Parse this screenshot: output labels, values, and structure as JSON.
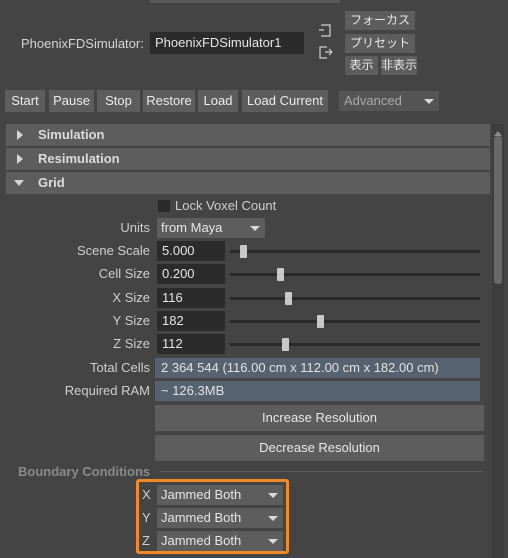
{
  "header": {
    "node_label": "PhoenixFDSimulator:",
    "node_value": "PhoenixFDSimulator1",
    "focus_label": "フォーカス",
    "preset_label": "プリセット",
    "show_label": "表示",
    "hide_label": "非表示"
  },
  "toolbar": {
    "buttons": [
      "Start",
      "Pause",
      "Stop",
      "Restore",
      "Load",
      "Load Current"
    ],
    "mode_selected": "Advanced"
  },
  "sections": {
    "simulation": "Simulation",
    "resimulation": "Resimulation",
    "grid": "Grid"
  },
  "grid": {
    "lock_voxel_label": "Lock Voxel Count",
    "units_label": "Units",
    "units_value": "from Maya",
    "scene_scale_label": "Scene Scale",
    "scene_scale_value": "5.000",
    "scene_scale_level": 0.05,
    "cell_size_label": "Cell Size",
    "cell_size_value": "0.200",
    "cell_size_level": 0.2,
    "x_size_label": "X Size",
    "x_size_value": "116",
    "x_size_level": 0.23,
    "y_size_label": "Y Size",
    "y_size_value": "182",
    "y_size_level": 0.36,
    "z_size_label": "Z Size",
    "z_size_value": "112",
    "z_size_level": 0.22,
    "total_cells_label": "Total Cells",
    "total_cells_value": "2 364 544 (116.00 cm x 112.00 cm x 182.00 cm)",
    "required_ram_label": "Required RAM",
    "required_ram_value": "~ 126.3MB",
    "increase_label": "Increase Resolution",
    "decrease_label": "Decrease Resolution"
  },
  "boundary": {
    "title": "Boundary Conditions",
    "x_label": "X",
    "x_value": "Jammed Both",
    "y_label": "Y",
    "y_value": "Jammed Both",
    "z_label": "Z",
    "z_value": "Jammed Both"
  },
  "colors": {
    "highlight_border": "#f08a24",
    "panel_background": "#444444",
    "section_header": "#5d5d5d",
    "info_field": "#566270"
  }
}
